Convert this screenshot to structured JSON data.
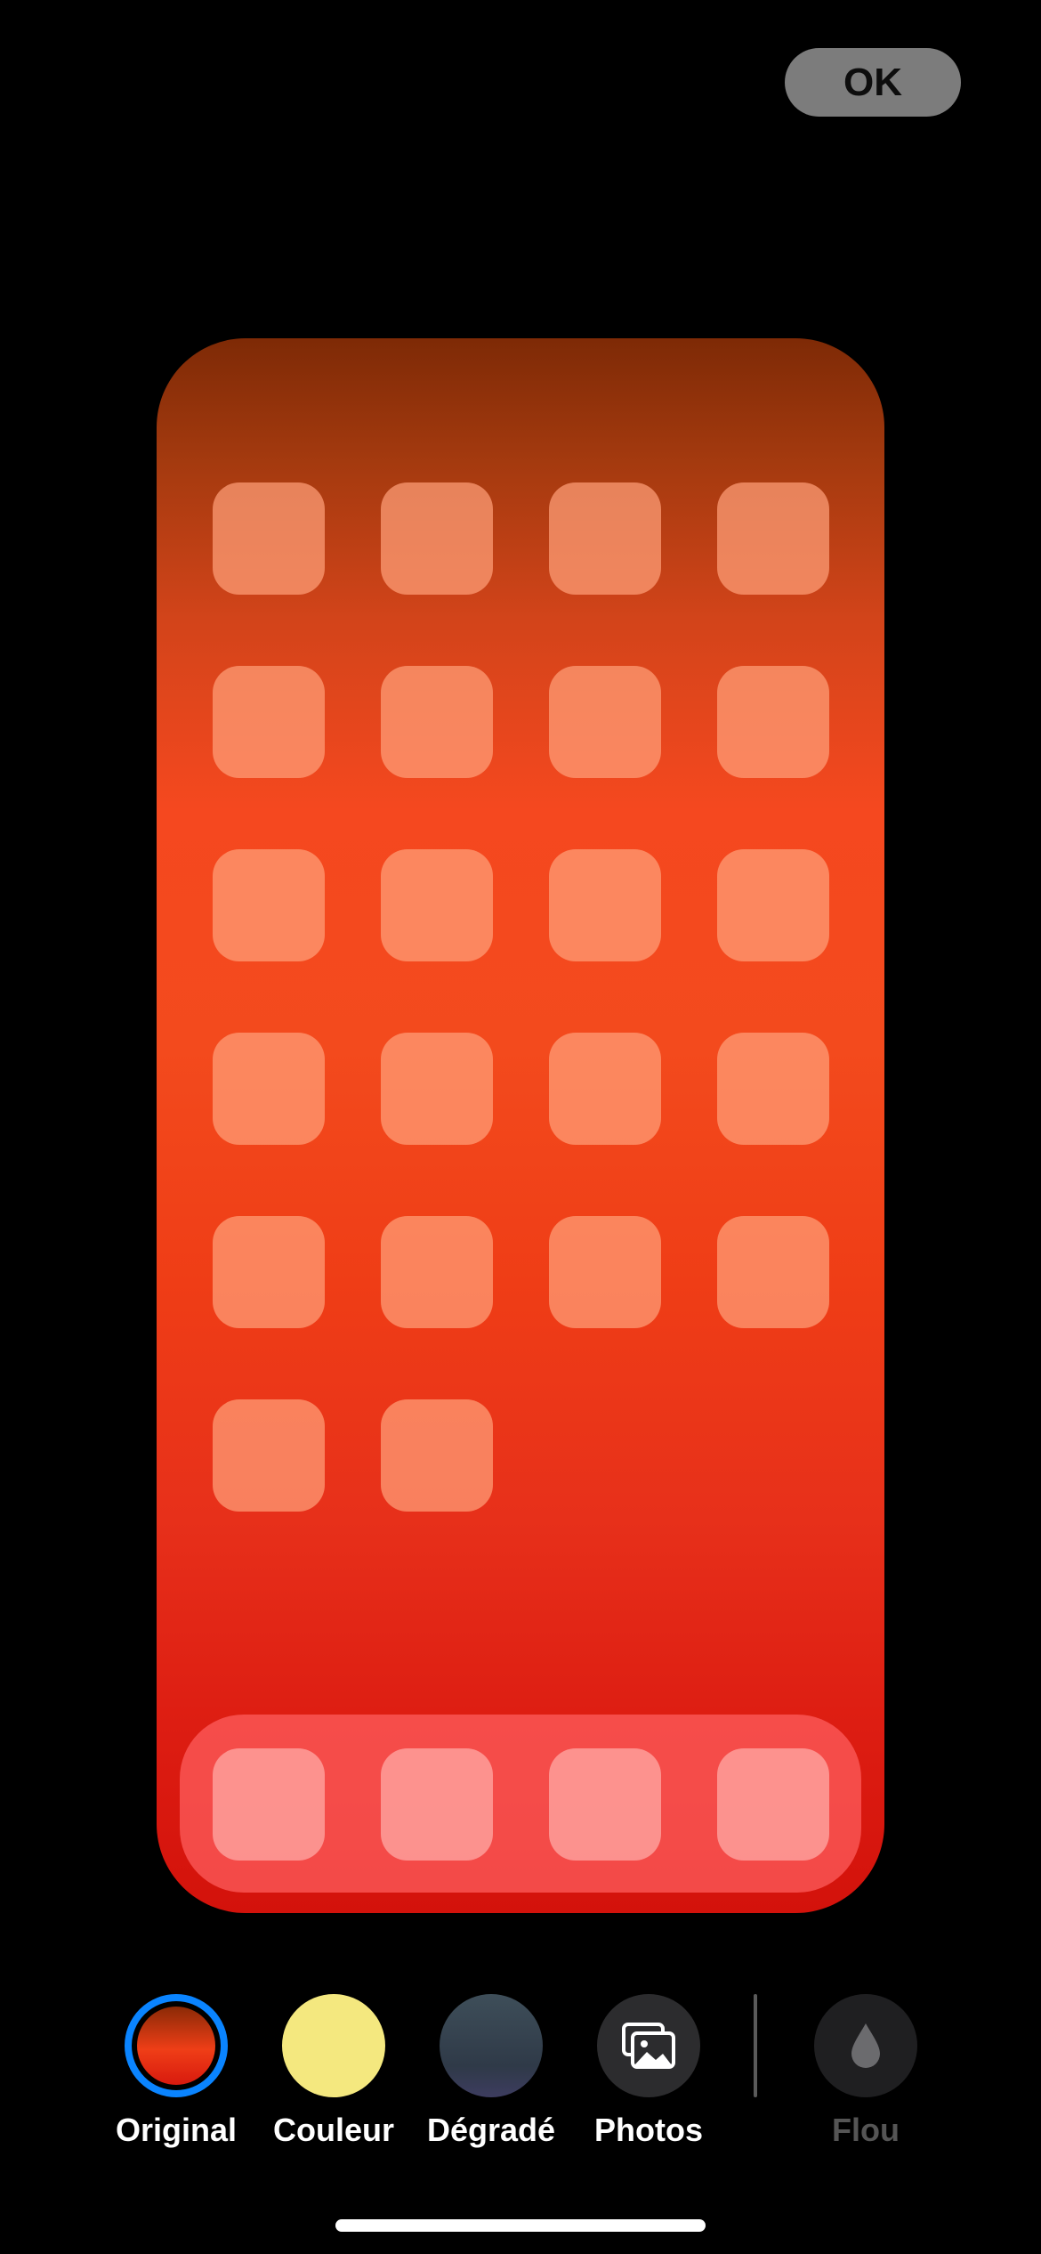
{
  "header": {
    "done_label": "OK"
  },
  "preview": {
    "grid_rows": 6,
    "app_icon_count": 22,
    "dock_icon_count": 4
  },
  "options": [
    {
      "label": "Original",
      "icon": "original-swatch",
      "selected": true
    },
    {
      "label": "Couleur",
      "icon": "color-swatch",
      "selected": false
    },
    {
      "label": "Dégradé",
      "icon": "gradient-swatch",
      "selected": false
    },
    {
      "label": "Photos",
      "icon": "photos-icon",
      "selected": false
    },
    {
      "label": "Flou",
      "icon": "blur-drop-icon",
      "selected": false,
      "disabled": true
    }
  ],
  "colors": {
    "selection_ring": "#0a84ff",
    "couleur_swatch": "#f4e87f",
    "wallpaper_top": "#7e2a06",
    "wallpaper_mid": "#f5481f",
    "wallpaper_bottom": "#d3120b"
  }
}
